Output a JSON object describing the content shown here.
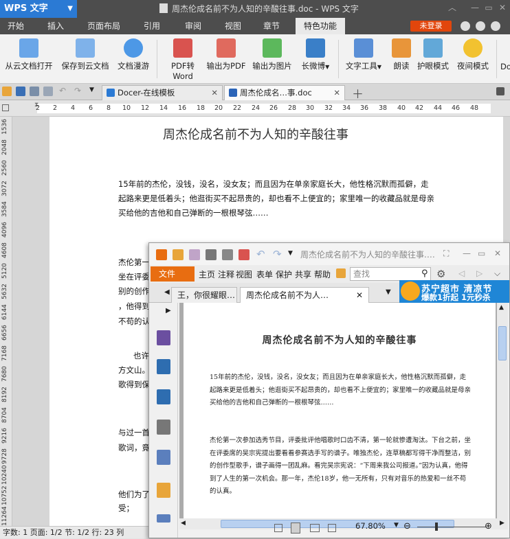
{
  "app": {
    "logo": "WPS 文字",
    "title": "周杰伦成名前不为人知的辛酸往事.doc - WPS 文字"
  },
  "menu": {
    "tabs": [
      "开始",
      "插入",
      "页面布局",
      "引用",
      "审阅",
      "视图",
      "章节",
      "特色功能"
    ],
    "active": "特色功能",
    "login": "未登录"
  },
  "ribbon": {
    "buttons": [
      "从云文档打开",
      "保存到云文档",
      "文档漫游",
      "PDF转Word",
      "输出为PDF",
      "输出为图片",
      "长微博",
      "文字工具",
      "朗读",
      "护眼模式",
      "夜间模式",
      "Do"
    ]
  },
  "tabs": {
    "docer": "Docer-在线模板",
    "doc": "周杰伦成名…事.doc"
  },
  "ruler": {
    "h": [
      "2",
      "2",
      "4",
      "6",
      "8",
      "10",
      "12",
      "14",
      "16",
      "18",
      "20",
      "22",
      "24",
      "26",
      "28",
      "30",
      "32",
      "34",
      "36",
      "38",
      "40",
      "42",
      "44",
      "46",
      "48"
    ],
    "v": [
      "1536",
      "2048",
      "2560",
      "3072",
      "3584",
      "4096",
      "4608",
      "5120",
      "5632",
      "6144",
      "6656",
      "7168",
      "7680",
      "8192",
      "8704",
      "9216",
      "9728",
      "10240",
      "10752",
      "11264",
      "11776"
    ]
  },
  "document": {
    "title": "周杰伦成名前不为人知的辛酸往事",
    "para1": "15年前的杰伦，没钱，没名，没女友；而且因为在单亲家庭长大，他性格沉默而孤僻，走起路来更是低着头；他逛街买不起昂贵的，却也看不上便宜的；家里唯一的收藏品就是母亲买给他的吉他和自己弹断的一根根琴弦……",
    "frags": [
      "杰伦第一次参",
      "坐在评委席的",
      "别的创作型歌",
      "，他得到了人",
      "不苟的认真。",
      "也许是他",
      "方文山。然而",
      "歌得到保留",
      "与过一首名为",
      "歌词，竟连握",
      "他们为了向宇",
      "受；"
    ]
  },
  "status": {
    "text": "字数: 1  页面: 1/2  节: 1/2  行: 23  列"
  },
  "popup": {
    "title": "周杰伦成名前不为人知的辛酸往事.…",
    "file": "文件",
    "menus": [
      "主页",
      "注释",
      "视图",
      "表单",
      "保护",
      "共享",
      "帮助"
    ],
    "search_placeholder": "查找",
    "tabs": [
      "王，你很耀眼…",
      "周杰伦成名前不为人…"
    ],
    "ad": {
      "line1": "苏宁超市  清凉节",
      "line2": "爆款1折起  1元秒杀"
    },
    "doc_title": "周杰伦成名前不为人知的辛酸往事",
    "para1": "15年前的杰伦，没钱，没名，没女友；而且因为在单亲家庭长大，他性格沉默而孤僻，走起路来更是低着头；他逛街买不起昂贵的，却也看不上便宜的；家里唯一的收藏品就是母亲买给他的吉他和自己弹断的一根根琴弦……",
    "para2": "杰伦第一次参加选秀节目，评委批评他唱歌时口齿不清，第一轮就惨遭淘汰。下台之前，坐在评委席的吴宗宪提出要看看参赛选手写的谱子。唯独杰伦，连草稿都写得干净而整洁，别的创作型歌手，谱子画得一团乱麻。看完吴宗宪说：“下周来我公司报道。”因为认真，他得到了人生的第一次机会。那一年，杰伦18岁，他一无所有，只有对音乐的热爱和一丝不苟的认真。",
    "zoom": "67.80%"
  },
  "colors": {
    "accent": "#2b7ad4",
    "orange": "#e86d11",
    "login": "#e2460c"
  }
}
